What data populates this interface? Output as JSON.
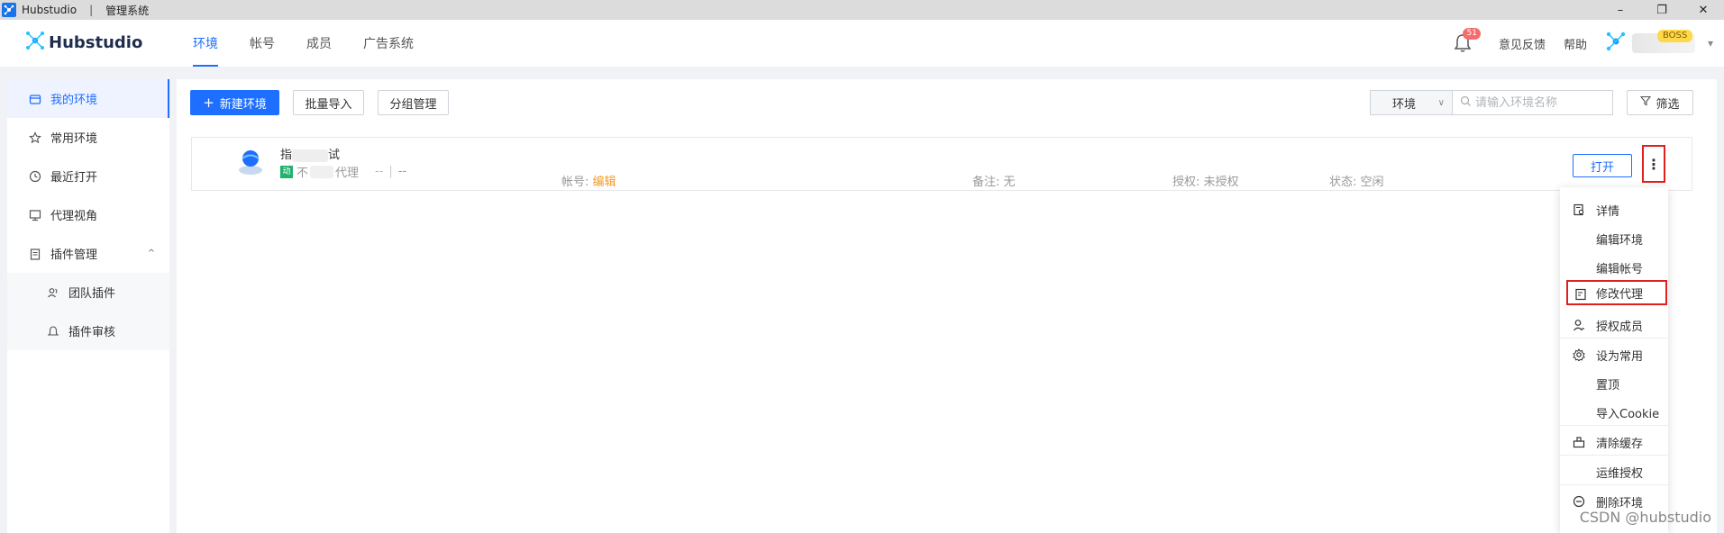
{
  "titlebar": {
    "app_name": "Hubstudio",
    "separator": "|",
    "section": "管理系统"
  },
  "window_controls": {
    "minimize": "–",
    "restore": "❐",
    "close": "✕"
  },
  "brand": {
    "name": "Hubstudio"
  },
  "nav": {
    "tabs": [
      {
        "label": "环境",
        "active": true
      },
      {
        "label": "帐号"
      },
      {
        "label": "成员"
      },
      {
        "label": "广告系统"
      }
    ]
  },
  "top_right": {
    "notification_count": "51",
    "feedback": "意见反馈",
    "help": "帮助",
    "user_badge": "BOSS",
    "menu_arrow": "▾"
  },
  "sidebar": {
    "items": [
      {
        "label": "我的环境",
        "icon": "shop-icon",
        "active": true
      },
      {
        "label": "常用环境",
        "icon": "star-icon"
      },
      {
        "label": "最近打开",
        "icon": "clock-icon"
      },
      {
        "label": "代理视角",
        "icon": "monitor-icon"
      },
      {
        "label": "插件管理",
        "icon": "clipboard-icon",
        "expanded": true
      }
    ],
    "sub_items": [
      {
        "label": "团队插件",
        "icon": "team-icon"
      },
      {
        "label": "插件审核",
        "icon": "bell-icon"
      }
    ],
    "chevron": "^"
  },
  "toolbar": {
    "new_env": "新建环境",
    "new_env_plus": "+",
    "batch_import": "批量导入",
    "group_manage": "分组管理",
    "env_select": "环境",
    "search_placeholder": "请输入环境名称",
    "filter": "筛选"
  },
  "env_row": {
    "name_prefix": "指",
    "name_suffix": "试",
    "dynamic_tag": "动",
    "proxy_prefix": "不",
    "proxy_suffix": "代理",
    "dash1": "--",
    "sep": "|",
    "dash2": "--",
    "account_label": "帐号:",
    "account_value": "编辑",
    "remark_label": "备注:",
    "remark_value": "无",
    "auth_label": "授权:",
    "auth_value": "未授权",
    "status_label": "状态:",
    "status_value": "空闲",
    "open_btn": "打开",
    "more_icon": "⋮"
  },
  "dropdown": {
    "items": [
      {
        "label": "详情",
        "icon": "detail-icon"
      },
      {
        "label": "编辑环境"
      },
      {
        "label": "编辑帐号"
      },
      {
        "label": "修改代理",
        "icon": "edit-proxy-icon",
        "highlighted": true
      },
      {
        "label": "授权成员",
        "icon": "user-icon"
      },
      {
        "label": "设为常用",
        "icon": "gear-icon"
      },
      {
        "label": "置顶"
      },
      {
        "label": "导入Cookie"
      },
      {
        "label": "清除缓存",
        "icon": "broom-icon"
      },
      {
        "label": "运维授权"
      },
      {
        "label": "删除环境",
        "icon": "minus-circle-icon"
      }
    ]
  },
  "watermark": "CSDN @hubstudio"
}
